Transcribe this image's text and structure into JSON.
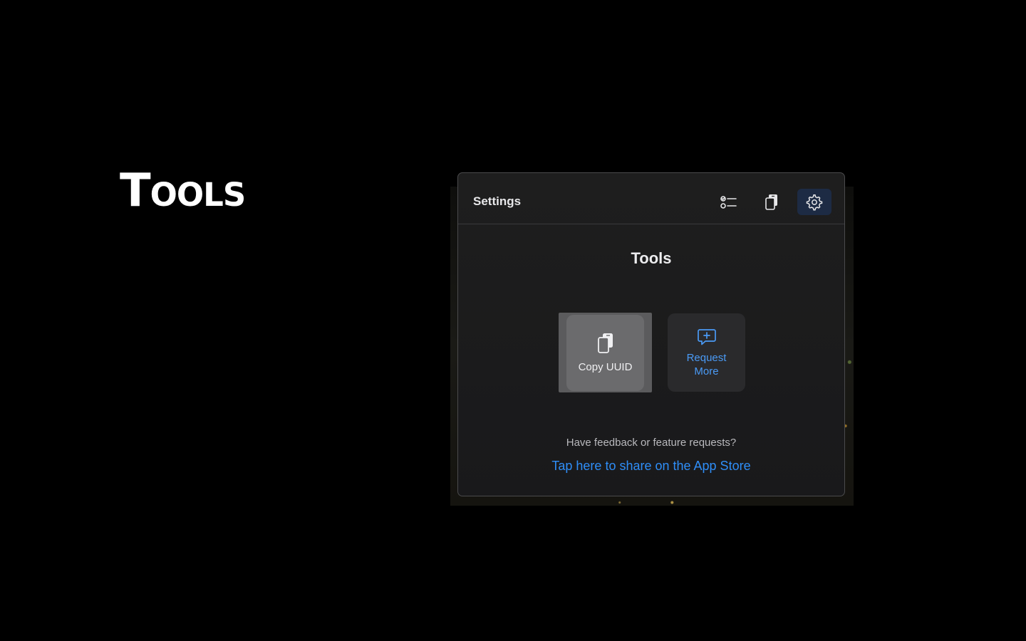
{
  "hero": {
    "title": "Tools"
  },
  "panel": {
    "header": {
      "title": "Settings",
      "buttons": [
        {
          "icon": "checklist-icon",
          "active": false
        },
        {
          "icon": "copy-documents-icon",
          "active": false
        },
        {
          "icon": "gear-icon",
          "active": true
        }
      ]
    },
    "section_title": "Tools",
    "tiles": [
      {
        "icon": "copy-documents-icon",
        "label": "Copy UUID"
      },
      {
        "icon": "message-plus-icon",
        "label": "Request More"
      }
    ],
    "feedback": {
      "question": "Have feedback or feature requests?",
      "link": "Tap here to share on the App Store"
    }
  },
  "colors": {
    "accent": "#2f8ef7",
    "active_tab_bg": "#1d2b44",
    "panel_bg": "#1e1e1e",
    "page_bg": "#000000"
  }
}
